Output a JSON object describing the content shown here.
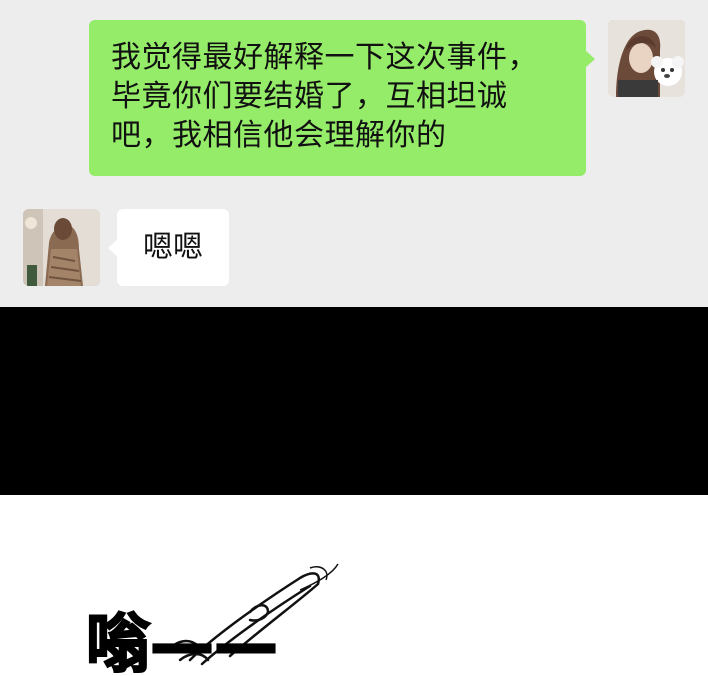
{
  "chat": {
    "outgoing": {
      "lines": [
        "我觉得最好解释一下这次事件，",
        "毕竟你们要结婚了，互相坦诚",
        "吧，我相信他会理解你的"
      ],
      "bubble_color": "#95ec69"
    },
    "incoming": {
      "text": "嗯嗯",
      "bubble_color": "#ffffff"
    },
    "background": "#ededed"
  },
  "panel": {
    "sound_effect": "嗡——"
  }
}
